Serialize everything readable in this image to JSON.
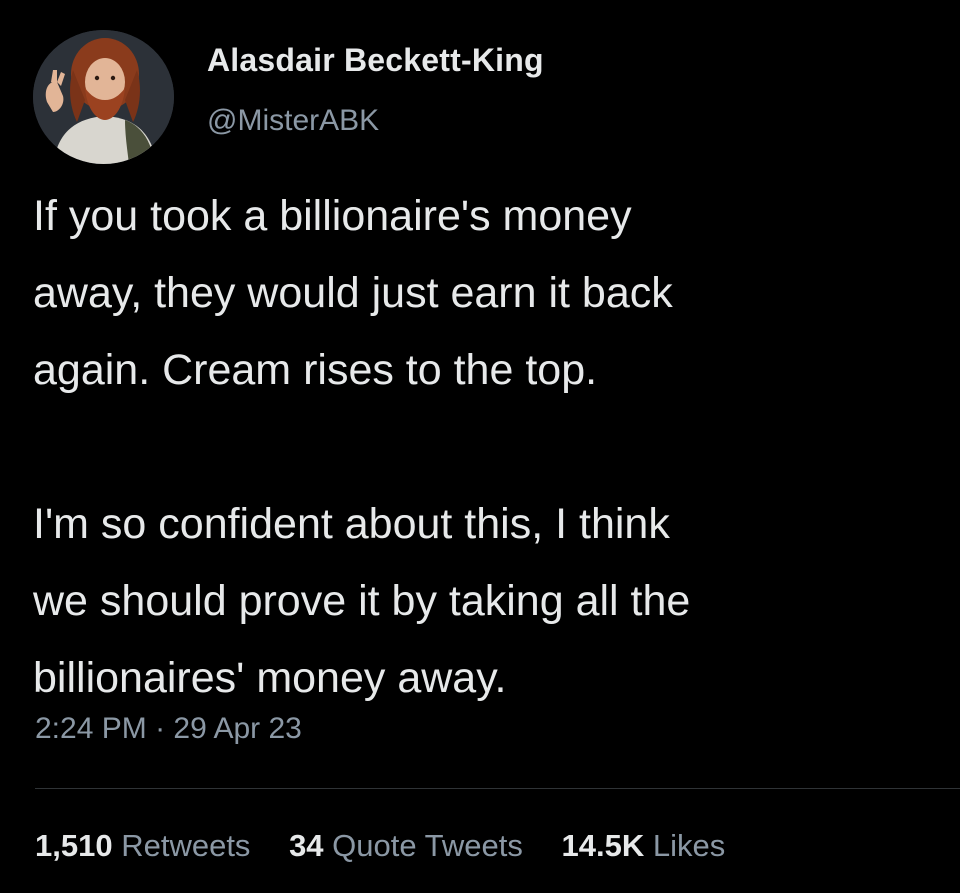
{
  "author": {
    "name": "Alasdair Beckett-King",
    "handle": "@MisterABK"
  },
  "tweet": {
    "paragraphs": [
      [
        "If you took a billionaire's money",
        "away, they would just earn it back",
        "again. Cream rises to the top."
      ],
      [
        "I'm so confident about this, I think",
        "we should prove it by taking all the",
        "billionaires' money away."
      ]
    ],
    "time": "2:24 PM",
    "separator": "·",
    "date": "29 Apr 23"
  },
  "stats": {
    "retweets": {
      "count": "1,510",
      "label": "Retweets"
    },
    "quotes": {
      "count": "34",
      "label": "Quote Tweets"
    },
    "likes": {
      "count": "14.5K",
      "label": "Likes"
    }
  },
  "colors": {
    "background": "#000000",
    "primary_text": "#e7e9ea",
    "secondary_text": "#8b98a5",
    "divider": "#2f3336"
  }
}
